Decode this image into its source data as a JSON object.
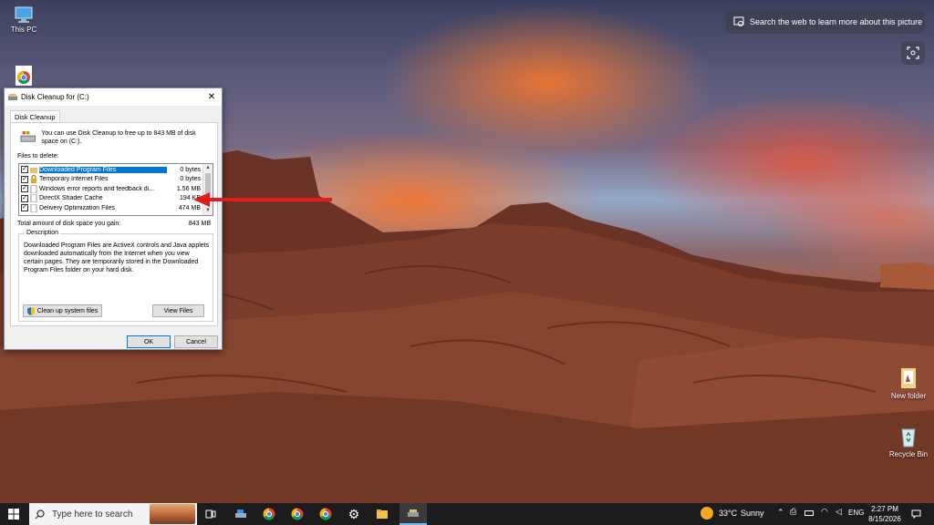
{
  "desktop": {
    "icons": {
      "this_pc": "This PC",
      "chrome": "",
      "new_folder": "New folder",
      "recycle_bin": "Recycle Bin"
    },
    "lens_search": "Search the web to learn more about this picture"
  },
  "dialog": {
    "title": "Disk Cleanup for  (C:)",
    "tab": "Disk Cleanup",
    "intro": "You can use Disk Cleanup to free up to 843 MB of disk space on  (C:).",
    "files_label": "Files to delete:",
    "files": [
      {
        "name": "Downloaded Program Files",
        "size": "0 bytes",
        "checked": true,
        "selected": true
      },
      {
        "name": "Temporary Internet Files",
        "size": "0 bytes",
        "checked": true,
        "selected": false
      },
      {
        "name": "Windows error reports and feedback di...",
        "size": "1.56 MB",
        "checked": true,
        "selected": false
      },
      {
        "name": "DirectX Shader Cache",
        "size": "194 KB",
        "checked": true,
        "selected": false
      },
      {
        "name": "Delivery Optimization Files",
        "size": "474 MB",
        "checked": true,
        "selected": false
      }
    ],
    "total_label": "Total amount of disk space you gain:",
    "total_value": "843 MB",
    "description_label": "Description",
    "description_text": "Downloaded Program Files are ActiveX controls and Java applets downloaded automatically from the Internet when you view certain pages. They are temporarily stored in the Downloaded Program Files folder on your hard disk.",
    "cleanup_system_label": "Clean up system files",
    "view_files_label": "View Files",
    "ok_label": "OK",
    "cancel_label": "Cancel"
  },
  "taskbar": {
    "search_placeholder": "Type here to search",
    "weather_temp": "33°C",
    "weather_text": "Sunny",
    "language": "ENG",
    "time": "2:27 PM",
    "date": "8/15/2026"
  },
  "colors": {
    "accent": "#0078d7",
    "arrow": "#e01c1c",
    "taskbar": "#1c1c1c"
  }
}
